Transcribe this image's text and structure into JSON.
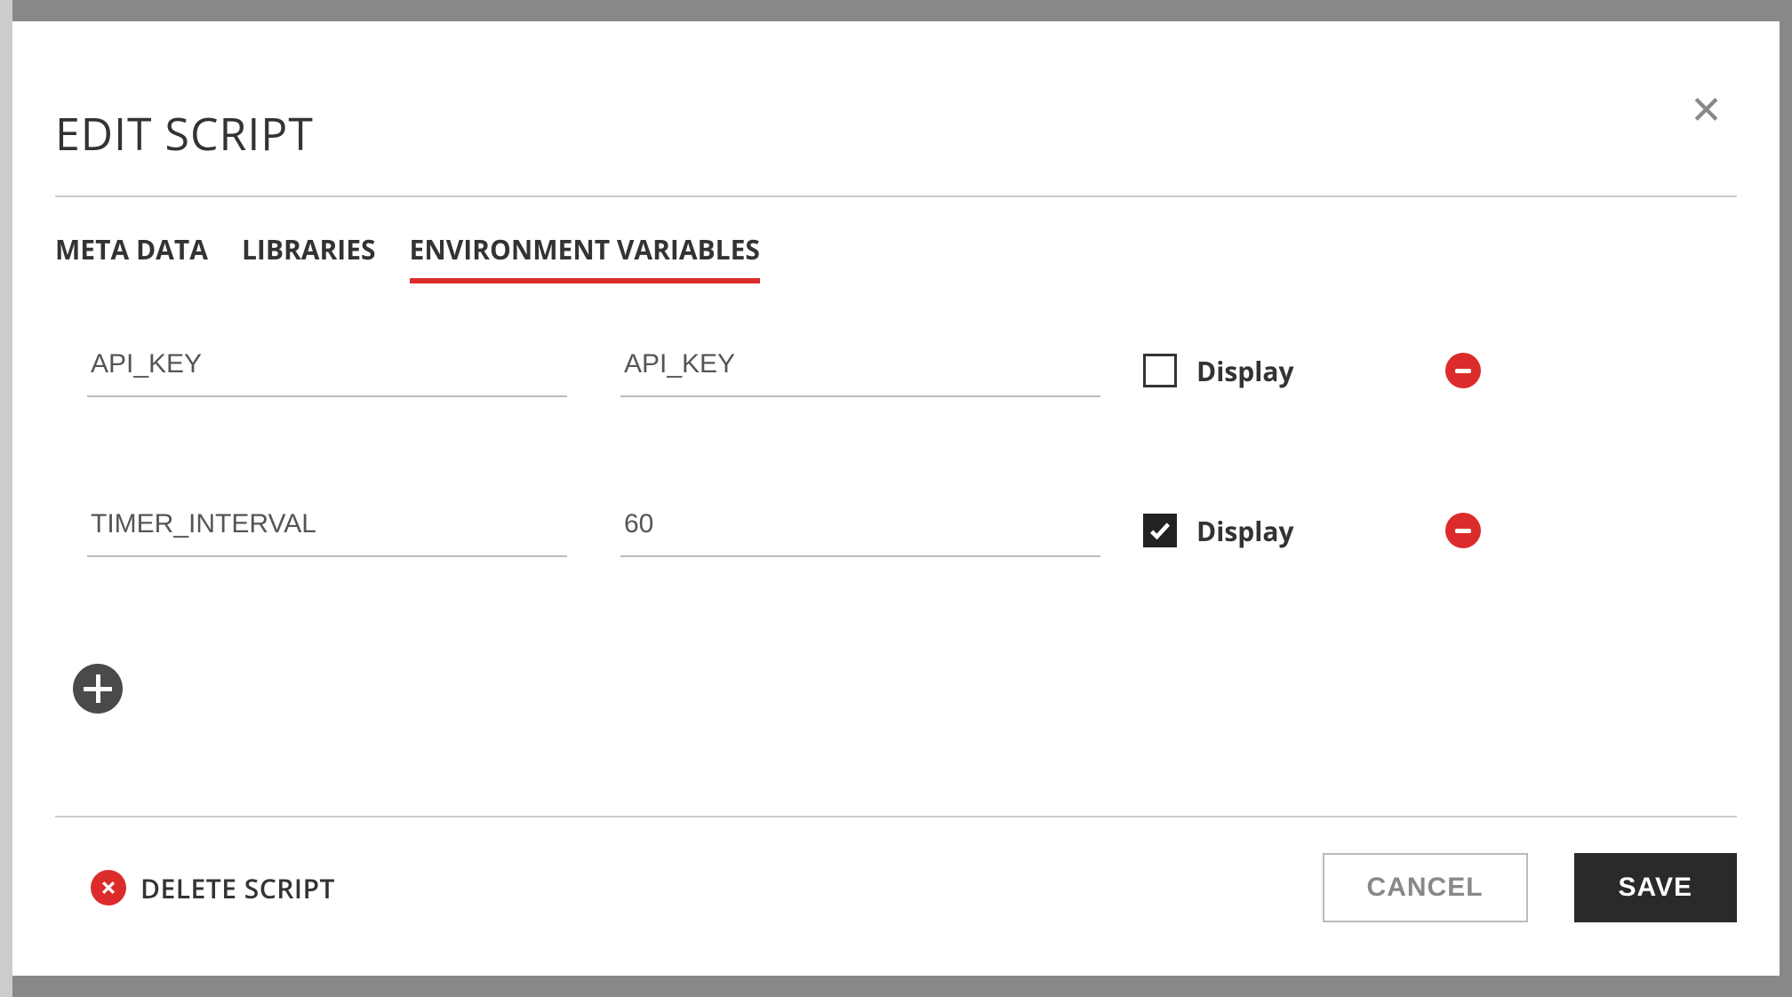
{
  "dialog": {
    "title": "EDIT SCRIPT"
  },
  "tabs": [
    {
      "label": "META DATA"
    },
    {
      "label": "LIBRARIES"
    },
    {
      "label": "ENVIRONMENT VARIABLES"
    }
  ],
  "env_vars": [
    {
      "name": "API_KEY",
      "value": "API_KEY",
      "display": false,
      "display_label": "Display"
    },
    {
      "name": "TIMER_INTERVAL",
      "value": "60",
      "display": true,
      "display_label": "Display"
    }
  ],
  "footer": {
    "delete_label": "DELETE SCRIPT",
    "cancel_label": "CANCEL",
    "save_label": "SAVE"
  }
}
